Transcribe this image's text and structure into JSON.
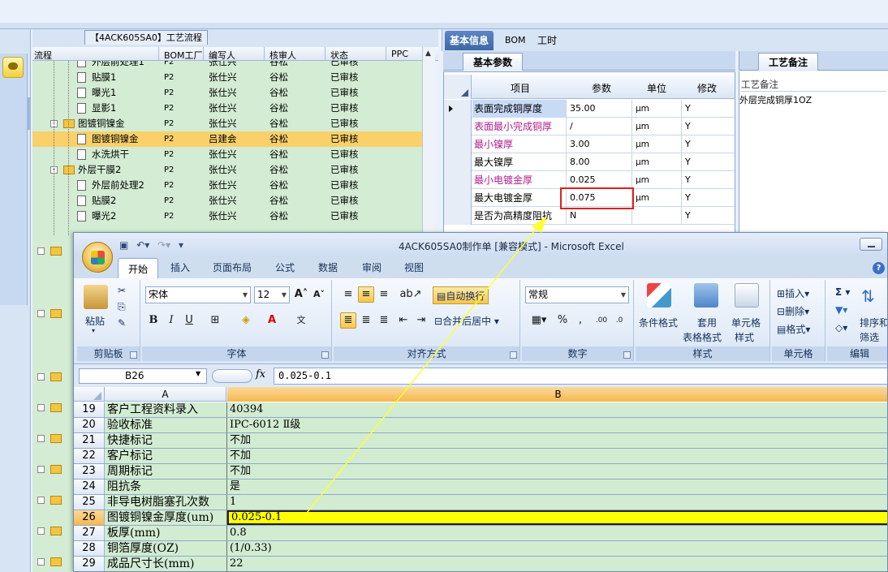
{
  "process_panel": {
    "tab_label": "【4ACK605SA0】工艺流程",
    "columns": [
      "流程",
      "BOM工厂",
      "编写人",
      "核审人",
      "状态",
      "PPC"
    ],
    "rows": [
      {
        "name": "外层前处理1",
        "factory": "P2",
        "writer": "张仕兴",
        "reviewer": "谷松",
        "status": "已审核",
        "type": "doc",
        "indent": 1
      },
      {
        "name": "贴膜1",
        "factory": "P2",
        "writer": "张仕兴",
        "reviewer": "谷松",
        "status": "已审核",
        "type": "doc",
        "indent": 1
      },
      {
        "name": "曝光1",
        "factory": "P2",
        "writer": "张仕兴",
        "reviewer": "谷松",
        "status": "已审核",
        "type": "doc",
        "indent": 1
      },
      {
        "name": "显影1",
        "factory": "P2",
        "writer": "张仕兴",
        "reviewer": "谷松",
        "status": "已审核",
        "type": "doc",
        "indent": 1
      },
      {
        "name": "图镀铜镍金",
        "factory": "P2",
        "writer": "张仕兴",
        "reviewer": "谷松",
        "status": "已审核",
        "type": "folder",
        "indent": 0
      },
      {
        "name": "图镀铜镍金",
        "factory": "P2",
        "writer": "吕建会",
        "reviewer": "谷松",
        "status": "已审核",
        "type": "doc",
        "indent": 1,
        "selected": true
      },
      {
        "name": "水洗烘干",
        "factory": "P2",
        "writer": "张仕兴",
        "reviewer": "谷松",
        "status": "已审核",
        "type": "doc",
        "indent": 1
      },
      {
        "name": "外层干膜2",
        "factory": "P2",
        "writer": "张仕兴",
        "reviewer": "谷松",
        "status": "已审核",
        "type": "folder",
        "indent": 0
      },
      {
        "name": "外层前处理2",
        "factory": "P2",
        "writer": "张仕兴",
        "reviewer": "谷松",
        "status": "已审核",
        "type": "doc",
        "indent": 1
      },
      {
        "name": "贴膜2",
        "factory": "P2",
        "writer": "张仕兴",
        "reviewer": "谷松",
        "status": "已审核",
        "type": "doc",
        "indent": 1
      },
      {
        "name": "曝光2",
        "factory": "P2",
        "writer": "张仕兴",
        "reviewer": "谷松",
        "status": "已审核",
        "type": "doc",
        "indent": 1
      }
    ]
  },
  "info_tabs": [
    "基本信息",
    "BOM",
    "工时"
  ],
  "params_panel": {
    "tab_label": "基本参数",
    "columns": [
      "项目",
      "参数",
      "单位",
      "修改"
    ],
    "rows": [
      {
        "name": "表面完成铜厚度",
        "value": "35.00",
        "unit": "μm",
        "edit": "Y",
        "style": "highlight"
      },
      {
        "name": "表面最小完成铜厚",
        "value": "/",
        "unit": "μm",
        "edit": "Y",
        "style": "magenta"
      },
      {
        "name": "最小镍厚",
        "value": "3.00",
        "unit": "μm",
        "edit": "Y",
        "style": "magenta"
      },
      {
        "name": "最大镍厚",
        "value": "8.00",
        "unit": "μm",
        "edit": "Y",
        "style": ""
      },
      {
        "name": "最小电镀金厚",
        "value": "0.025",
        "unit": "μm",
        "edit": "Y",
        "style": "magenta"
      },
      {
        "name": "最大电镀金厚",
        "value": "0.075",
        "unit": "μm",
        "edit": "Y",
        "style": ""
      },
      {
        "name": "是否为高精度阻抗",
        "value": "N",
        "unit": "",
        "edit": "Y",
        "style": ""
      }
    ]
  },
  "remarks_panel": {
    "tab_label": "工艺备注",
    "header": "工艺备注",
    "text": "外层完成铜厚1OZ"
  },
  "excel": {
    "title": "4ACK605SA0制作单 [兼容模式] - Microsoft Excel",
    "tabs": [
      "开始",
      "插入",
      "页面布局",
      "公式",
      "数据",
      "审阅",
      "视图"
    ],
    "ribbon": {
      "paste": "粘贴",
      "clipboard": "剪贴板",
      "font_name": "宋体",
      "font_size": "12",
      "font": "字体",
      "wrap": "自动换行",
      "merge": "合并后居中",
      "align": "对齐方式",
      "number_format": "常规",
      "number": "数字",
      "cond_format": "条件格式",
      "table_format_1": "套用",
      "table_format_2": "表格格式",
      "cell_style_1": "单元格",
      "cell_style_2": "样式",
      "styles": "样式",
      "insert": "插入",
      "delete": "删除",
      "format": "格式",
      "cells": "单元格",
      "sort_1": "排序和",
      "sort_2": "筛选",
      "editing": "编辑"
    },
    "name_box": "B26",
    "formula": "0.025-0.1",
    "col_a": "A",
    "col_b": "B",
    "rows": [
      {
        "n": "19",
        "a": "客户工程资料录入",
        "b": "40394"
      },
      {
        "n": "20",
        "a": "验收标准",
        "b": "IPC-6012 Ⅱ级"
      },
      {
        "n": "21",
        "a": "快捷标记",
        "b": "不加"
      },
      {
        "n": "22",
        "a": "客户标记",
        "b": "不加"
      },
      {
        "n": "23",
        "a": "周期标记",
        "b": "不加"
      },
      {
        "n": "24",
        "a": "阻抗条",
        "b": "是"
      },
      {
        "n": "25",
        "a": "非导电树脂塞孔次数",
        "b": "1"
      },
      {
        "n": "26",
        "a": "图镀铜镍金厚度(um)",
        "b": "0.025-0.1",
        "active": true
      },
      {
        "n": "27",
        "a": "板厚(mm)",
        "b": "0.8"
      },
      {
        "n": "28",
        "a": "铜箔厚度(OZ)",
        "b": "(1/0.33)"
      },
      {
        "n": "29",
        "a": "成品尺寸长(mm)",
        "b": "22"
      }
    ]
  },
  "annotation_colors": {
    "arrow": "#ffff33",
    "highlight_box": "#e02020",
    "selected_row": "#f9d06a",
    "excel_active": "#ffff00"
  }
}
